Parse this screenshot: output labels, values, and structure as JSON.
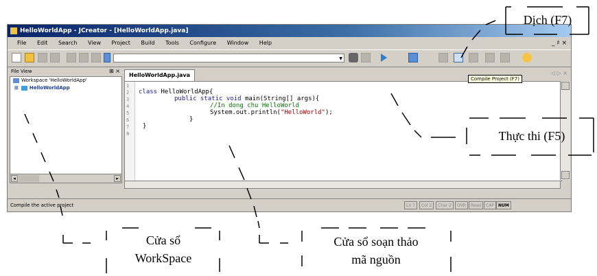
{
  "window": {
    "title": "HelloWorldApp - JCreator - [HelloWorldApp.java]",
    "mdi_controls": "_ ♯ ×"
  },
  "menu": [
    "File",
    "Edit",
    "Search",
    "View",
    "Project",
    "Build",
    "Tools",
    "Configure",
    "Window",
    "Help"
  ],
  "toolbar": {
    "tooltip": "Compile Project (F7)"
  },
  "file_view": {
    "title": "File View",
    "controls": "⊞ ×",
    "workspace_label": "Workspace 'HelloWorldApp'",
    "project_label": "HelloWorldApp",
    "expander": "⊞"
  },
  "editor": {
    "tab_label": "HelloWorldApp.java",
    "tab_controls": "◁ ▷ ×",
    "line_numbers": [
      "1",
      "2",
      "3",
      "4",
      "5",
      "6",
      "7",
      "8"
    ],
    "code": {
      "l2_kw": "class",
      "l2_rest": " HelloWorldApp{",
      "l3_kw": "public static void",
      "l3_rest": " main(String[] args){",
      "l4_comment": "//In dong chu HelloWorld",
      "l5_pre": "System.out.println(",
      "l5_str": "\"HelloWorld\"",
      "l5_post": ");",
      "l6": "}",
      "l7": "}"
    }
  },
  "statusbar": {
    "message": "Compile the active project",
    "cells": [
      "Ln 7",
      "Col 2",
      "Char 2",
      "OVR",
      "Read",
      "CAP",
      "NUM"
    ]
  },
  "annotations": {
    "compile": "Dịch (F7)",
    "run": "Thực thi (F5)",
    "workspace_line1": "Cửa sổ",
    "workspace_line2": "WorkSpace",
    "editor_line1": "Cửa sổ soạn thảo",
    "editor_line2": "mã nguồn"
  }
}
